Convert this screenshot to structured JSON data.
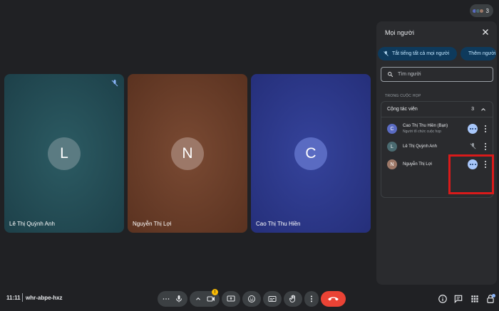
{
  "meeting": {
    "time": "11:11",
    "code": "whr-abpe-hxz",
    "people_count": "3"
  },
  "tiles": [
    {
      "initial": "L",
      "name": "Lê Thị Quỳnh Anh",
      "muted": true
    },
    {
      "initial": "N",
      "name": "Nguyễn Thị Lợi",
      "muted": false
    },
    {
      "initial": "C",
      "name": "Cao Thị Thu Hiền",
      "muted": false
    }
  ],
  "panel": {
    "title": "Mọi người",
    "mute_all_label": "Tắt tiếng tất cả mọi người",
    "add_people_label": "Thêm người",
    "search_placeholder": "Tìm người",
    "section_label": "TRONG CUỘC HỌP",
    "group": {
      "title": "Cộng tác viên",
      "count": "3"
    },
    "participants": [
      {
        "initial": "C",
        "name": "Cao Thị Thu Hiền (Bạn)",
        "role": "Người tổ chức cuộc họp",
        "status": "speaking-indicator",
        "avatar_color": "#5a6bc2"
      },
      {
        "initial": "L",
        "name": "Lê Thị Quỳnh Anh",
        "role": "",
        "status": "mic-off",
        "avatar_color": "#4a6a70"
      },
      {
        "initial": "N",
        "name": "Nguyễn Thị Lợi",
        "role": "",
        "status": "speaking-indicator",
        "avatar_color": "#9c7868"
      }
    ]
  },
  "colors": {
    "accent": "#a8c7fa",
    "end_call": "#ea4335",
    "highlight": "#d91a1a",
    "warning": "#fbbc04"
  },
  "icons": [
    "more-options-icon",
    "microphone-icon",
    "chevron-up-icon",
    "camera-icon",
    "present-screen-icon",
    "emoji-icon",
    "captions-icon",
    "raise-hand-icon",
    "end-call-icon",
    "info-icon",
    "chat-icon",
    "activities-icon",
    "host-controls-icon"
  ]
}
